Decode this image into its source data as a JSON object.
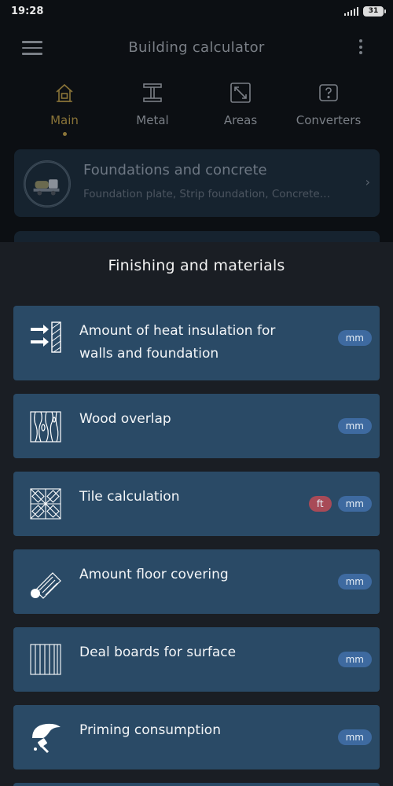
{
  "status_bar": {
    "time": "19:28",
    "battery": "31"
  },
  "app_bar": {
    "title": "Building calculator",
    "menu_icon": "hamburger-menu-icon",
    "more_icon": "more-vertical-icon"
  },
  "tabs": [
    {
      "label": "Main",
      "icon": "house-icon",
      "active": true
    },
    {
      "label": "Metal",
      "icon": "i-beam-icon",
      "active": false
    },
    {
      "label": "Areas",
      "icon": "expand-arrows-icon",
      "active": false
    },
    {
      "label": "Converters",
      "icon": "convert-icon",
      "active": false
    }
  ],
  "foundation_card": {
    "title": "Foundations and concrete",
    "subtitle": "Foundation plate, Strip foundation, Concrete…",
    "icon": "concrete-mixer-icon"
  },
  "sheet": {
    "title": "Finishing and materials",
    "items": [
      {
        "label": "Amount of heat insulation for walls and foundation",
        "icon": "heat-insulation-icon",
        "badges": [
          "mm"
        ]
      },
      {
        "label": "Wood overlap",
        "icon": "wood-grain-icon",
        "badges": [
          "mm"
        ]
      },
      {
        "label": "Tile calculation",
        "icon": "tile-pattern-icon",
        "badges": [
          "ft",
          "mm"
        ]
      },
      {
        "label": "Amount floor covering",
        "icon": "floor-roll-icon",
        "badges": [
          "mm"
        ]
      },
      {
        "label": "Deal boards for surface",
        "icon": "boards-icon",
        "badges": [
          "mm"
        ]
      },
      {
        "label": "Priming consumption",
        "icon": "primer-brush-icon",
        "badges": [
          "mm"
        ]
      }
    ]
  },
  "colors": {
    "sheet_bg": "#1a1e24",
    "card_bg": "#2a4a66",
    "badge_mm": "#3e6aa0",
    "badge_ft": "#a84a57",
    "active_tab": "#8a7438"
  }
}
